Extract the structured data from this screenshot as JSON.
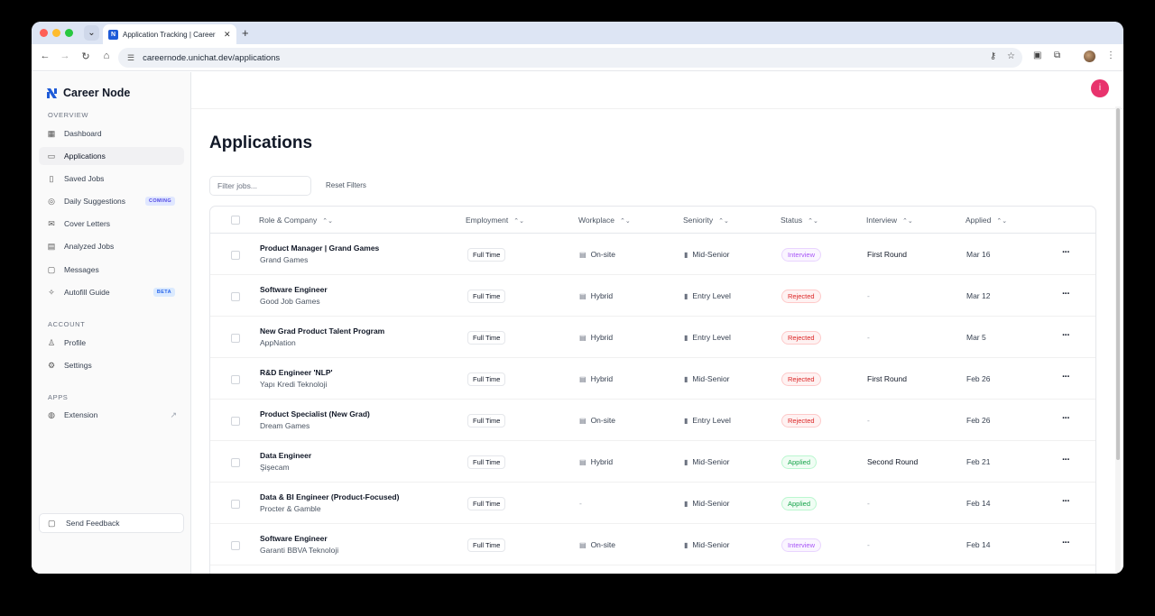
{
  "browser": {
    "tab_title": "Application Tracking | Career",
    "url": "careernode.unichat.dev/applications",
    "new_tab_label": "+",
    "tab_close_label": "✕"
  },
  "sidebar": {
    "brand": "Career Node",
    "sections": [
      {
        "label": "OVERVIEW"
      },
      {
        "label": "ACCOUNT"
      },
      {
        "label": "APPS"
      }
    ],
    "items": [
      {
        "label": "Dashboard",
        "icon": "dashboard-icon",
        "glyph": "▦"
      },
      {
        "label": "Applications",
        "icon": "briefcase-icon",
        "glyph": "▭"
      },
      {
        "label": "Saved Jobs",
        "icon": "bookmark-icon",
        "glyph": "▯"
      },
      {
        "label": "Daily Suggestions",
        "icon": "target-icon",
        "glyph": "◎",
        "tag": "COMING"
      },
      {
        "label": "Cover Letters",
        "icon": "mail-icon",
        "glyph": "✉"
      },
      {
        "label": "Analyzed Jobs",
        "icon": "file-icon",
        "glyph": "▤"
      },
      {
        "label": "Messages",
        "icon": "chat-icon",
        "glyph": "▢"
      },
      {
        "label": "Autofill Guide",
        "icon": "wand-icon",
        "glyph": "✧",
        "tag": "BETA"
      },
      {
        "label": "Profile",
        "icon": "user-icon",
        "glyph": "♙"
      },
      {
        "label": "Settings",
        "icon": "gear-icon",
        "glyph": "⚙"
      },
      {
        "label": "Extension",
        "icon": "extension-icon",
        "glyph": "◍"
      }
    ],
    "feedback_label": "Send Feedback"
  },
  "main": {
    "avatar_letter": "i",
    "title": "Applications",
    "filter_placeholder": "Filter jobs...",
    "reset_label": "Reset Filters",
    "columns": [
      "Role & Company",
      "Employment",
      "Workplace",
      "Seniority",
      "Status",
      "Interview",
      "Applied"
    ],
    "sort_glyph": "⌃⌄",
    "rows": [
      {
        "role": "Product Manager | Grand Games",
        "company": "Grand Games",
        "employment": "Full Time",
        "workplace": "On-site",
        "seniority": "Mid-Senior",
        "status": "Interview",
        "interview": "First Round",
        "applied": "Mar 16"
      },
      {
        "role": "Software Engineer",
        "company": "Good Job Games",
        "employment": "Full Time",
        "workplace": "Hybrid",
        "seniority": "Entry Level",
        "status": "Rejected",
        "interview": "-",
        "applied": "Mar 12"
      },
      {
        "role": "New Grad Product Talent Program",
        "company": "AppNation",
        "employment": "Full Time",
        "workplace": "Hybrid",
        "seniority": "Entry Level",
        "status": "Rejected",
        "interview": "-",
        "applied": "Mar 5"
      },
      {
        "role": "R&D Engineer 'NLP'",
        "company": "Yapı Kredi Teknoloji",
        "employment": "Full Time",
        "workplace": "Hybrid",
        "seniority": "Mid-Senior",
        "status": "Rejected",
        "interview": "First Round",
        "applied": "Feb 26"
      },
      {
        "role": "Product Specialist (New Grad)",
        "company": "Dream Games",
        "employment": "Full Time",
        "workplace": "On-site",
        "seniority": "Entry Level",
        "status": "Rejected",
        "interview": "-",
        "applied": "Feb 26"
      },
      {
        "role": "Data Engineer",
        "company": "Şişecam",
        "employment": "Full Time",
        "workplace": "Hybrid",
        "seniority": "Mid-Senior",
        "status": "Applied",
        "interview": "Second Round",
        "applied": "Feb 21"
      },
      {
        "role": "Data & BI Engineer (Product-Focused)",
        "company": "Procter & Gamble",
        "employment": "Full Time",
        "workplace": "-",
        "seniority": "Mid-Senior",
        "status": "Applied",
        "interview": "-",
        "applied": "Feb 14"
      },
      {
        "role": "Software Engineer",
        "company": "Garanti BBVA Teknoloji",
        "employment": "Full Time",
        "workplace": "On-site",
        "seniority": "Mid-Senior",
        "status": "Interview",
        "interview": "-",
        "applied": "Feb 14"
      }
    ]
  },
  "colors": {
    "accent": "#1e5bd8",
    "avatar": "#e8336d",
    "interview": "#a855f7",
    "rejected": "#dc2626",
    "applied": "#16a34a"
  }
}
